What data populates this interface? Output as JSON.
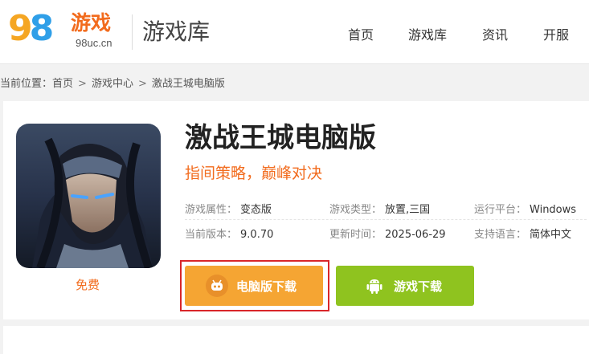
{
  "header": {
    "logo": {
      "digits": "98",
      "name": "游戏",
      "domain": "98uc.cn"
    },
    "site_title": "游戏库",
    "nav": [
      "首页",
      "游戏库",
      "资讯",
      "开服"
    ]
  },
  "breadcrumb": {
    "prefix": "当前位置：",
    "items": [
      "首页",
      "游戏中心",
      "激战王城电脑版"
    ],
    "separator": ">"
  },
  "game": {
    "title": "激战王城电脑版",
    "slogan": "指间策略，巅峰对决",
    "price_label": "免费",
    "meta": [
      {
        "key": "游戏属性：",
        "value": "变态版"
      },
      {
        "key": "游戏类型：",
        "value": "放置,三国"
      },
      {
        "key": "运行平台：",
        "value": "Windows"
      },
      {
        "key": "当前版本：",
        "value": "9.0.70"
      },
      {
        "key": "更新时间：",
        "value": "2025-06-29"
      },
      {
        "key": "支持语言：",
        "value": "简体中文"
      }
    ]
  },
  "buttons": {
    "pc_download": "电脑版下载",
    "mobile_download": "游戏下载"
  },
  "colors": {
    "accent_orange": "#f26b1d",
    "pc_button": "#f5a533",
    "mobile_button": "#8fc31f",
    "highlight_frame": "#d9262a"
  }
}
